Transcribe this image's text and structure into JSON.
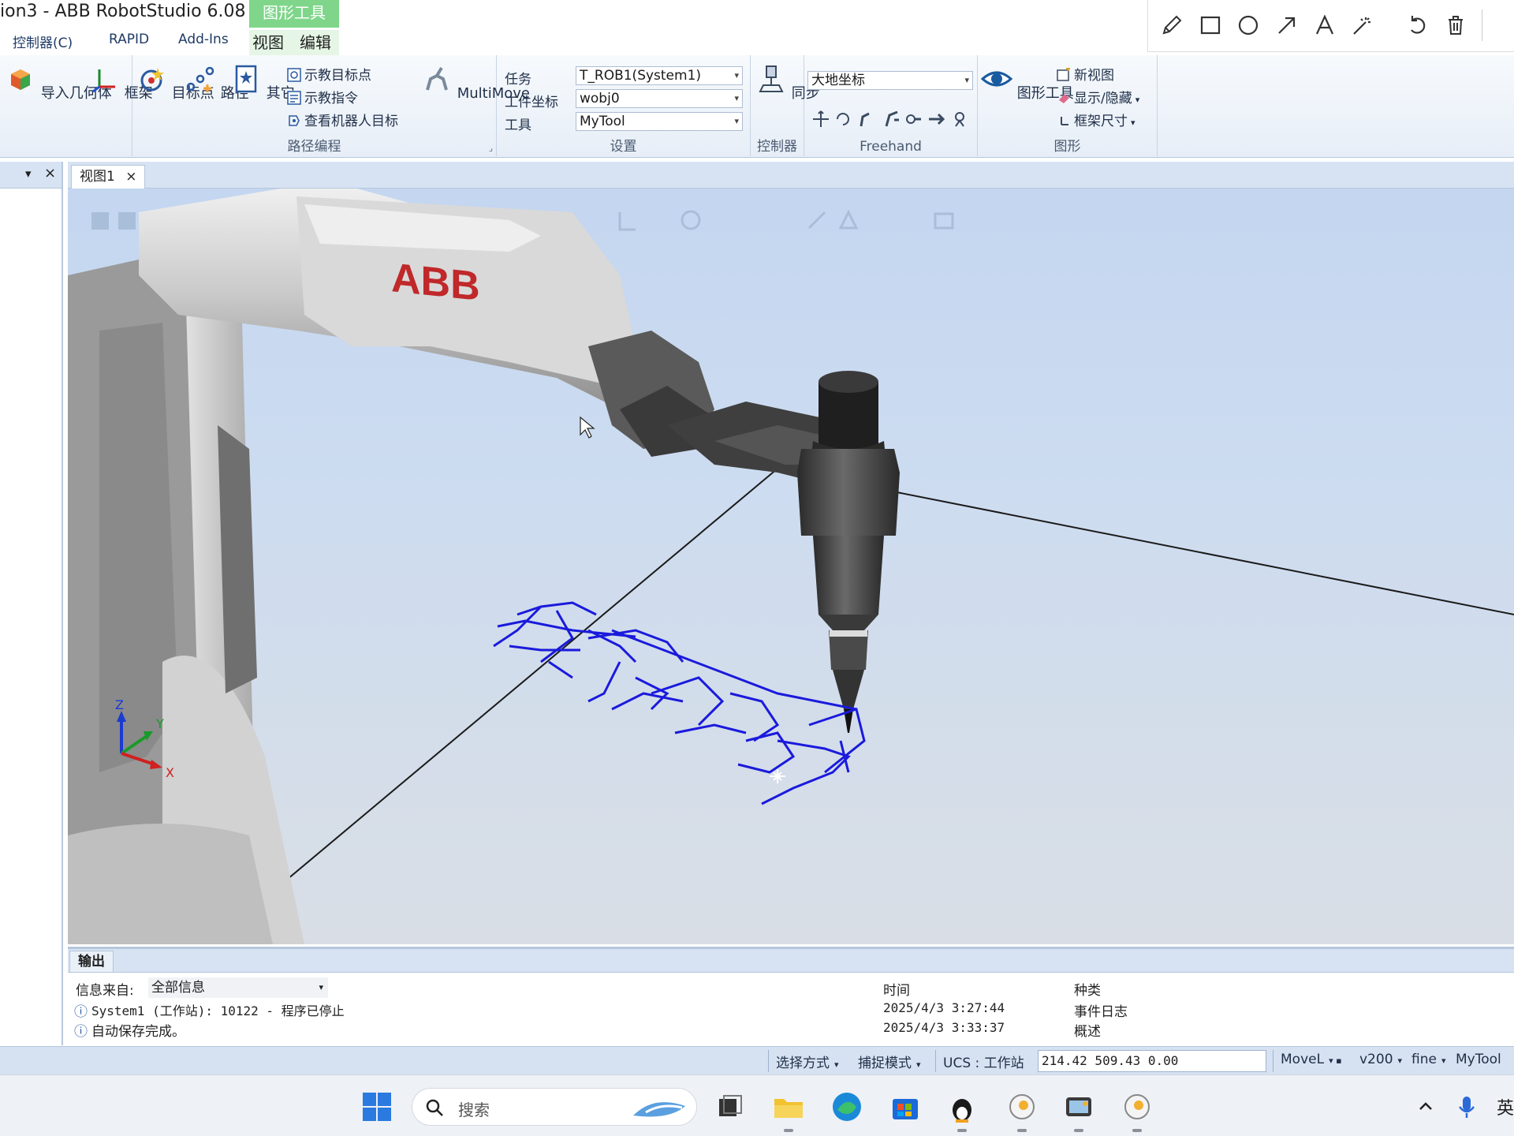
{
  "window": {
    "title": "ion3 - ABB RobotStudio 6.08",
    "contextual_tab_header": "图形工具"
  },
  "ribbon_tabs": [
    "控制器(C)",
    "RAPID",
    "Add-Ins",
    "视图",
    "编辑"
  ],
  "ribbon": {
    "import_geometry": "导入几何体",
    "frame": "框架",
    "target": "目标点",
    "path": "路径",
    "other": "其它",
    "teach_target": "示教目标点",
    "teach_instruction": "示教指令",
    "view_robot_target": "查看机器人目标",
    "multimove": "MultiMove",
    "group_path_programming": "路径编程",
    "task_label": "任务",
    "workobject_label": "工件坐标",
    "tool_label": "工具",
    "task_value": "T_ROB1(System1)",
    "workobject_value": "wobj0",
    "tool_value": "MyTool",
    "group_settings": "设置",
    "sync": "同步",
    "group_controller": "控制器",
    "frame_select": "大地坐标",
    "group_freehand": "Freehand",
    "graphics_tools": "图形工具",
    "new_view": "新视图",
    "show_hide": "显示/隐藏",
    "frame_size": "框架尺寸",
    "group_graphics": "图形"
  },
  "doc_tab": {
    "label": "视图1",
    "close": "×"
  },
  "left_panel": {
    "pin": "▾",
    "close": "×"
  },
  "viewport": {
    "robot_brand": "ABB",
    "axis_x": "X",
    "axis_y": "Y",
    "axis_z": "Z"
  },
  "output": {
    "tab": "输出",
    "source_label": "信息来自:",
    "source_value": "全部信息",
    "col_time": "时间",
    "col_category": "种类",
    "rows": [
      {
        "message": "System1 (工作站): 10122 - 程序已停止",
        "time": "2025/4/3 3:27:44",
        "category": "事件日志"
      },
      {
        "message": "自动保存完成。",
        "time": "2025/4/3 3:33:37",
        "category": "概述"
      }
    ]
  },
  "statusbar": {
    "selection_mode": "选择方式",
    "snap_mode": "捕捉模式",
    "ucs": "UCS : 工作站",
    "coordinates": "214.42   509.43   0.00",
    "move_instr": "MoveL",
    "speed": "v200",
    "zone": "fine",
    "tool": "MyTool"
  },
  "taskbar": {
    "search_placeholder": "搜索",
    "ime": "英"
  },
  "colors": {
    "ribbon_bg": "#e7eef7",
    "viewport_bg": "#cddcf0",
    "path_blue": "#1a1adc",
    "context_green": "#7fd68a"
  }
}
